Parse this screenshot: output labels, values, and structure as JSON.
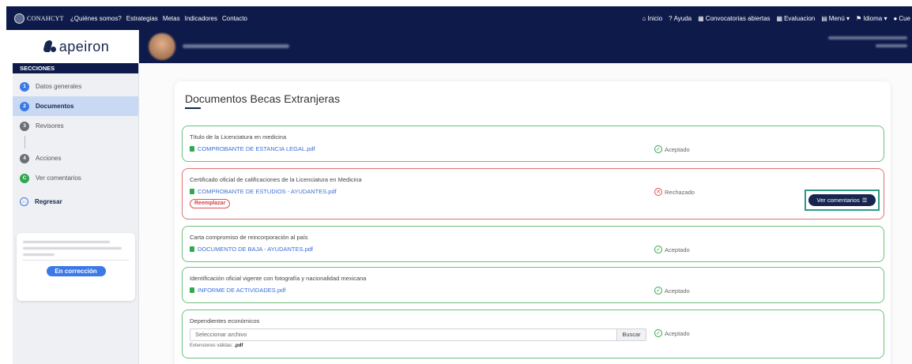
{
  "topbar": {
    "logo_text": "CONAHCYT",
    "nav": [
      "¿Quiénes somos?",
      "Estrategias",
      "Metas",
      "Indicadores",
      "Contacto"
    ],
    "right": [
      {
        "icon": "home-icon",
        "label": "Inicio"
      },
      {
        "icon": "help-icon",
        "label": "Ayuda"
      },
      {
        "icon": "calendar-icon",
        "label": "Convocatorias abiertas"
      },
      {
        "icon": "calendar-icon",
        "label": "Evaluacion"
      },
      {
        "icon": "menu-icon",
        "label": "Menú ▾"
      },
      {
        "icon": "flag-icon",
        "label": "Idioma ▾"
      },
      {
        "icon": "user-icon",
        "label": "Cue"
      }
    ]
  },
  "sidebar": {
    "brand": "apeiron",
    "sections_heading": "SECCIONES",
    "steps": [
      {
        "num": "1",
        "label": "Datos generales"
      },
      {
        "num": "2",
        "label": "Documentos"
      },
      {
        "num": "3",
        "label": "Revisores"
      },
      {
        "num": "4",
        "label": "Acciones"
      },
      {
        "num": "C",
        "label": "Ver comentarios"
      }
    ],
    "back": "Regresar",
    "status_badge": "En corrección"
  },
  "main": {
    "title": "Documentos Becas Extranjeras",
    "documents": [
      {
        "title": "Título de la Licenciatura en medicina",
        "file": "COMPROBANTE DE ESTANCIA LEGAL.pdf",
        "status": "Aceptado"
      },
      {
        "title": "Certificado oficial de calificaciones de la Licenciatura en Medicina",
        "file": "COMPROBANTE DE ESTUDIOS - AYUDANTES.pdf",
        "status": "Rechazado",
        "replace": "Reemplazar",
        "comments": "Ver comentarios"
      },
      {
        "title": "Carta compromiso de reincorporación al país",
        "file": "DOCUMENTO DE BAJA - AYUDANTES.pdf",
        "status": "Aceptado"
      },
      {
        "title": "Identificación oficial vigente con fotografía y nacionalidad mexicana",
        "file": "INFORME DE ACTIVIDADES.pdf",
        "status": "Aceptado"
      },
      {
        "title": "Dependientes económicos",
        "input_placeholder": "Seleccionar archivo",
        "search_label": "Buscar",
        "extensions_label": "Extensiones válidas:",
        "extensions": ".pdf",
        "status": "Aceptado"
      }
    ]
  },
  "colors": {
    "navy": "#0e1a4a",
    "accent": "#3a79e6",
    "accepted": "#2fa84f",
    "rejected": "#e05050"
  }
}
